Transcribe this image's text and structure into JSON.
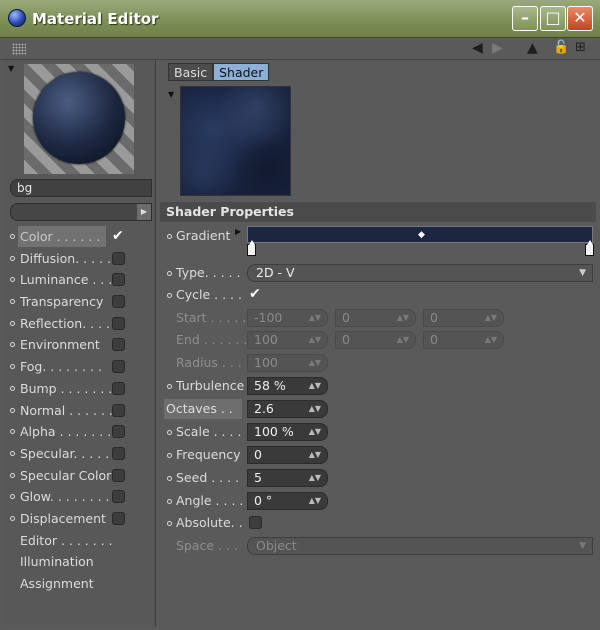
{
  "window": {
    "title": "Material Editor"
  },
  "material": {
    "name": "bg"
  },
  "tabs": [
    {
      "label": "Basic",
      "active": false
    },
    {
      "label": "Shader",
      "active": true
    }
  ],
  "channels": [
    {
      "label": "Color . . . . . .",
      "checked": true,
      "dot": true,
      "active": true
    },
    {
      "label": "Diffusion. . . . .",
      "checked": false,
      "dot": true
    },
    {
      "label": "Luminance . . . .",
      "checked": false,
      "dot": true
    },
    {
      "label": "Transparency",
      "checked": false,
      "dot": true
    },
    {
      "label": "Reflection. . . .",
      "checked": false,
      "dot": true
    },
    {
      "label": "Environment",
      "checked": false,
      "dot": true
    },
    {
      "label": "Fog. . . . . . . .",
      "checked": false,
      "dot": true
    },
    {
      "label": "Bump . . . . . . .",
      "checked": false,
      "dot": true
    },
    {
      "label": "Normal . . . . . .",
      "checked": false,
      "dot": true
    },
    {
      "label": "Alpha . . . . . . .",
      "checked": false,
      "dot": true
    },
    {
      "label": "Specular. . . . .",
      "checked": false,
      "dot": true
    },
    {
      "label": "Specular Color",
      "checked": false,
      "dot": true
    },
    {
      "label": "Glow. . . . . . . .",
      "checked": false,
      "dot": true
    },
    {
      "label": "Displacement",
      "checked": false,
      "dot": true
    },
    {
      "label": "Editor . . . . . . .",
      "dot": false
    },
    {
      "label": "Illumination",
      "dot": false
    },
    {
      "label": "Assignment",
      "dot": false
    }
  ],
  "shader": {
    "header": "Shader Properties",
    "gradient_label": "Gradient",
    "gradient_color": "#1b2640",
    "type": {
      "label": "Type. . . . .",
      "value": "2D - V"
    },
    "cycle": {
      "label": "Cycle . . . .",
      "checked": true
    },
    "start": {
      "label": "Start . . . . .",
      "values": [
        "-100",
        "0",
        "0"
      ]
    },
    "end": {
      "label": "End . . . . . .",
      "values": [
        "100",
        "0",
        "0"
      ]
    },
    "radius": {
      "label": "Radius . . . .",
      "value": "100"
    },
    "turbulence": {
      "label": "Turbulence",
      "value": "58 %"
    },
    "octaves": {
      "label": "Octaves . .",
      "value": "2.6"
    },
    "scale": {
      "label": "Scale . . . .",
      "value": "100 %"
    },
    "frequency": {
      "label": "Frequency",
      "value": "0"
    },
    "seed": {
      "label": "Seed . . . .",
      "value": "5"
    },
    "angle": {
      "label": "Angle . . . .",
      "value": "0 °"
    },
    "absolute": {
      "label": "Absolute. .",
      "checked": false
    },
    "space": {
      "label": "Space . . .",
      "value": "Object"
    }
  },
  "colors": {
    "panel": "#5a5a5a",
    "tab_active": "#8db0d8",
    "titlebar": "#7e9058",
    "close_button": "#c24420"
  },
  "icons": [
    "grip-icon",
    "back-arrow-icon",
    "forward-arrow-icon",
    "up-arrow-icon",
    "lock-icon",
    "new-window-icon"
  ]
}
